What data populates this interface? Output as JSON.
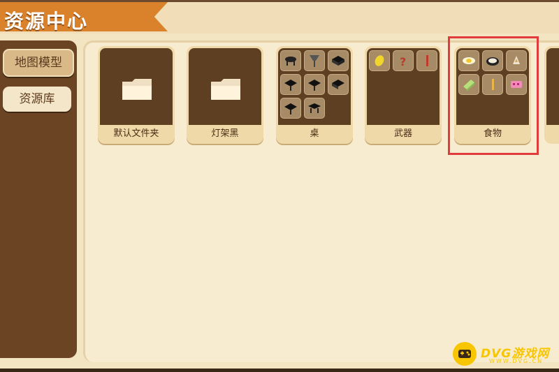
{
  "header": {
    "title": "资源中心"
  },
  "sidebar": {
    "tabs": [
      {
        "label": "地图模型",
        "active": true
      },
      {
        "label": "资源库",
        "active": false
      }
    ]
  },
  "cards": [
    {
      "label": "默认文件夹",
      "kind": "folder",
      "icon": "folder-icon"
    },
    {
      "label": "灯架黑",
      "kind": "folder",
      "icon": "folder-icon"
    },
    {
      "label": "桌",
      "kind": "thumbnails",
      "thumbnails": [
        "table-icon",
        "lamp-icon",
        "table-icon",
        "table-icon",
        "table-icon",
        "table-icon",
        "table-icon",
        "table-icon"
      ]
    },
    {
      "label": "武器",
      "kind": "thumbnails",
      "thumbnails": [
        "coin-icon",
        "question-icon",
        "stick-icon"
      ]
    },
    {
      "label": "食物",
      "kind": "thumbnails",
      "highlighted": true,
      "thumbnails": [
        "egg-icon",
        "plate-icon",
        "fish-icon",
        "cheese-icon",
        "bread-stick-icon",
        "candy-icon"
      ]
    }
  ],
  "watermark": {
    "text": "DVG游戏网",
    "sub": "WWW.DVG.CN"
  },
  "colors": {
    "accent": "#d9822b",
    "sidebar": "#6a4423",
    "highlight": "#e23b3b",
    "card_body": "#5e3f22"
  }
}
